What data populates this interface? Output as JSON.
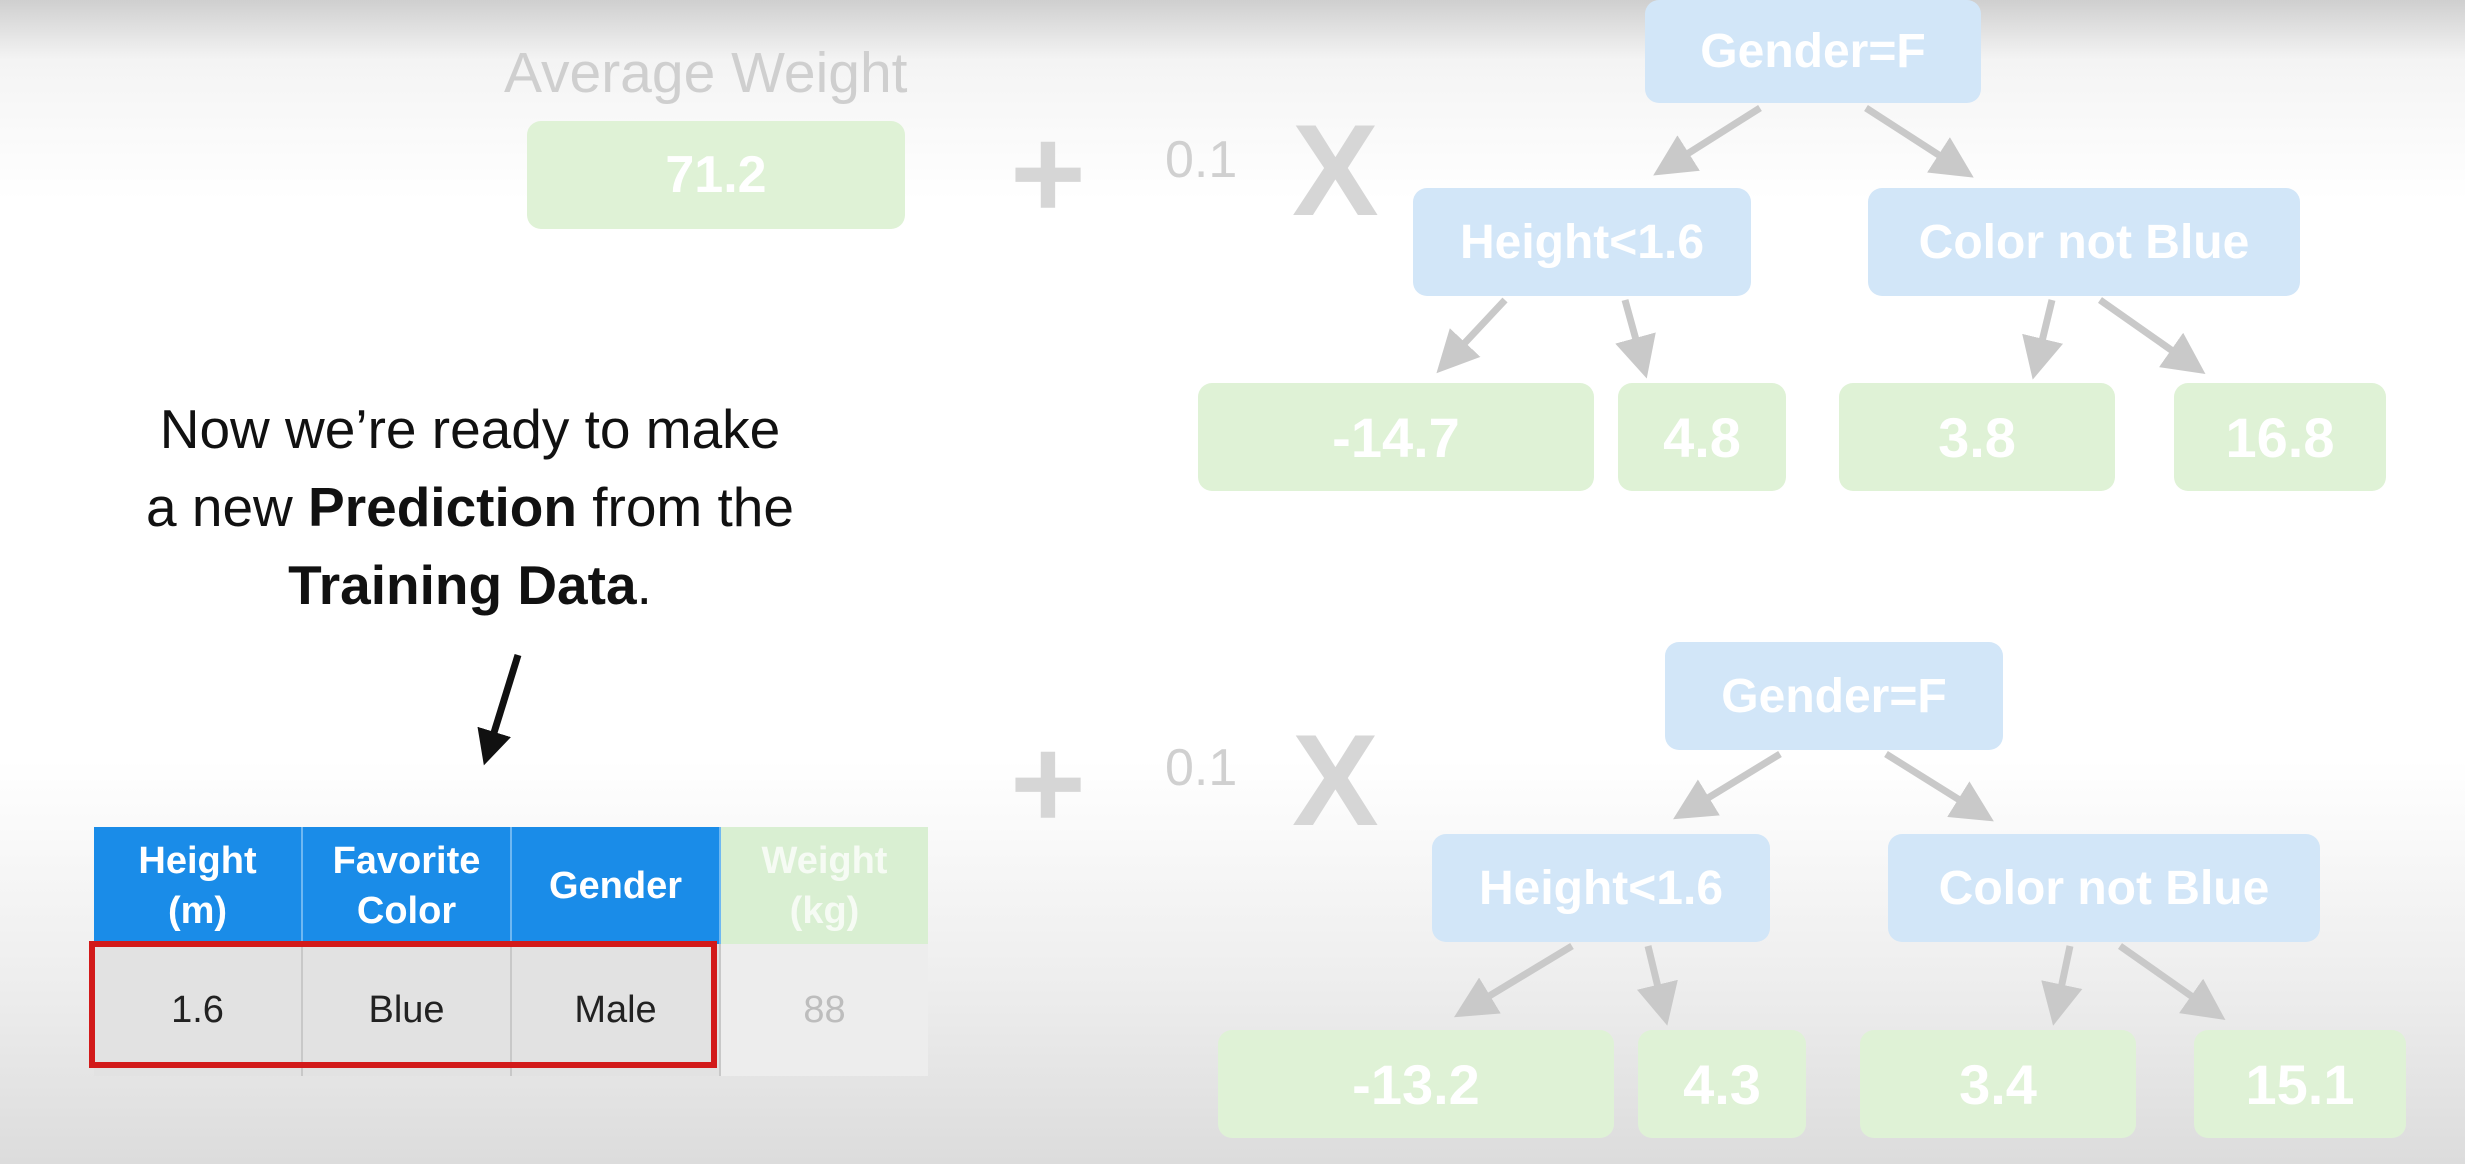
{
  "average": {
    "title": "Average Weight",
    "value": "71.2"
  },
  "learning_rate": "0.1",
  "plus_symbol": "+",
  "times_symbol": "X",
  "trees": [
    {
      "root": "Gender=F",
      "left_node": "Height<1.6",
      "right_node": "Color not Blue",
      "leaves": [
        "-14.7",
        "4.8",
        "3.8",
        "16.8"
      ]
    },
    {
      "root": "Gender=F",
      "left_node": "Height<1.6",
      "right_node": "Color not Blue",
      "leaves": [
        "-13.2",
        "4.3",
        "3.4",
        "15.1"
      ]
    }
  ],
  "caption": {
    "part1": "Now we’re ready to make",
    "part2": "a new ",
    "bold1": "Prediction",
    "part3": " from the",
    "bold2": "Training Data",
    "part4": "."
  },
  "table": {
    "headers": [
      {
        "line1": "Height",
        "line2": "(m)"
      },
      {
        "line1": "Favorite",
        "line2": "Color"
      },
      {
        "line1": "Gender",
        "line2": ""
      },
      {
        "line1": "Weight",
        "line2": "(kg)"
      }
    ],
    "row": [
      "1.6",
      "Blue",
      "Male",
      "88"
    ]
  },
  "colors": {
    "header_blue": "#1a8ce8",
    "highlight_red": "#d21a1a",
    "leaf_green": "#dff2d6",
    "node_blue": "#d2e6f8"
  }
}
